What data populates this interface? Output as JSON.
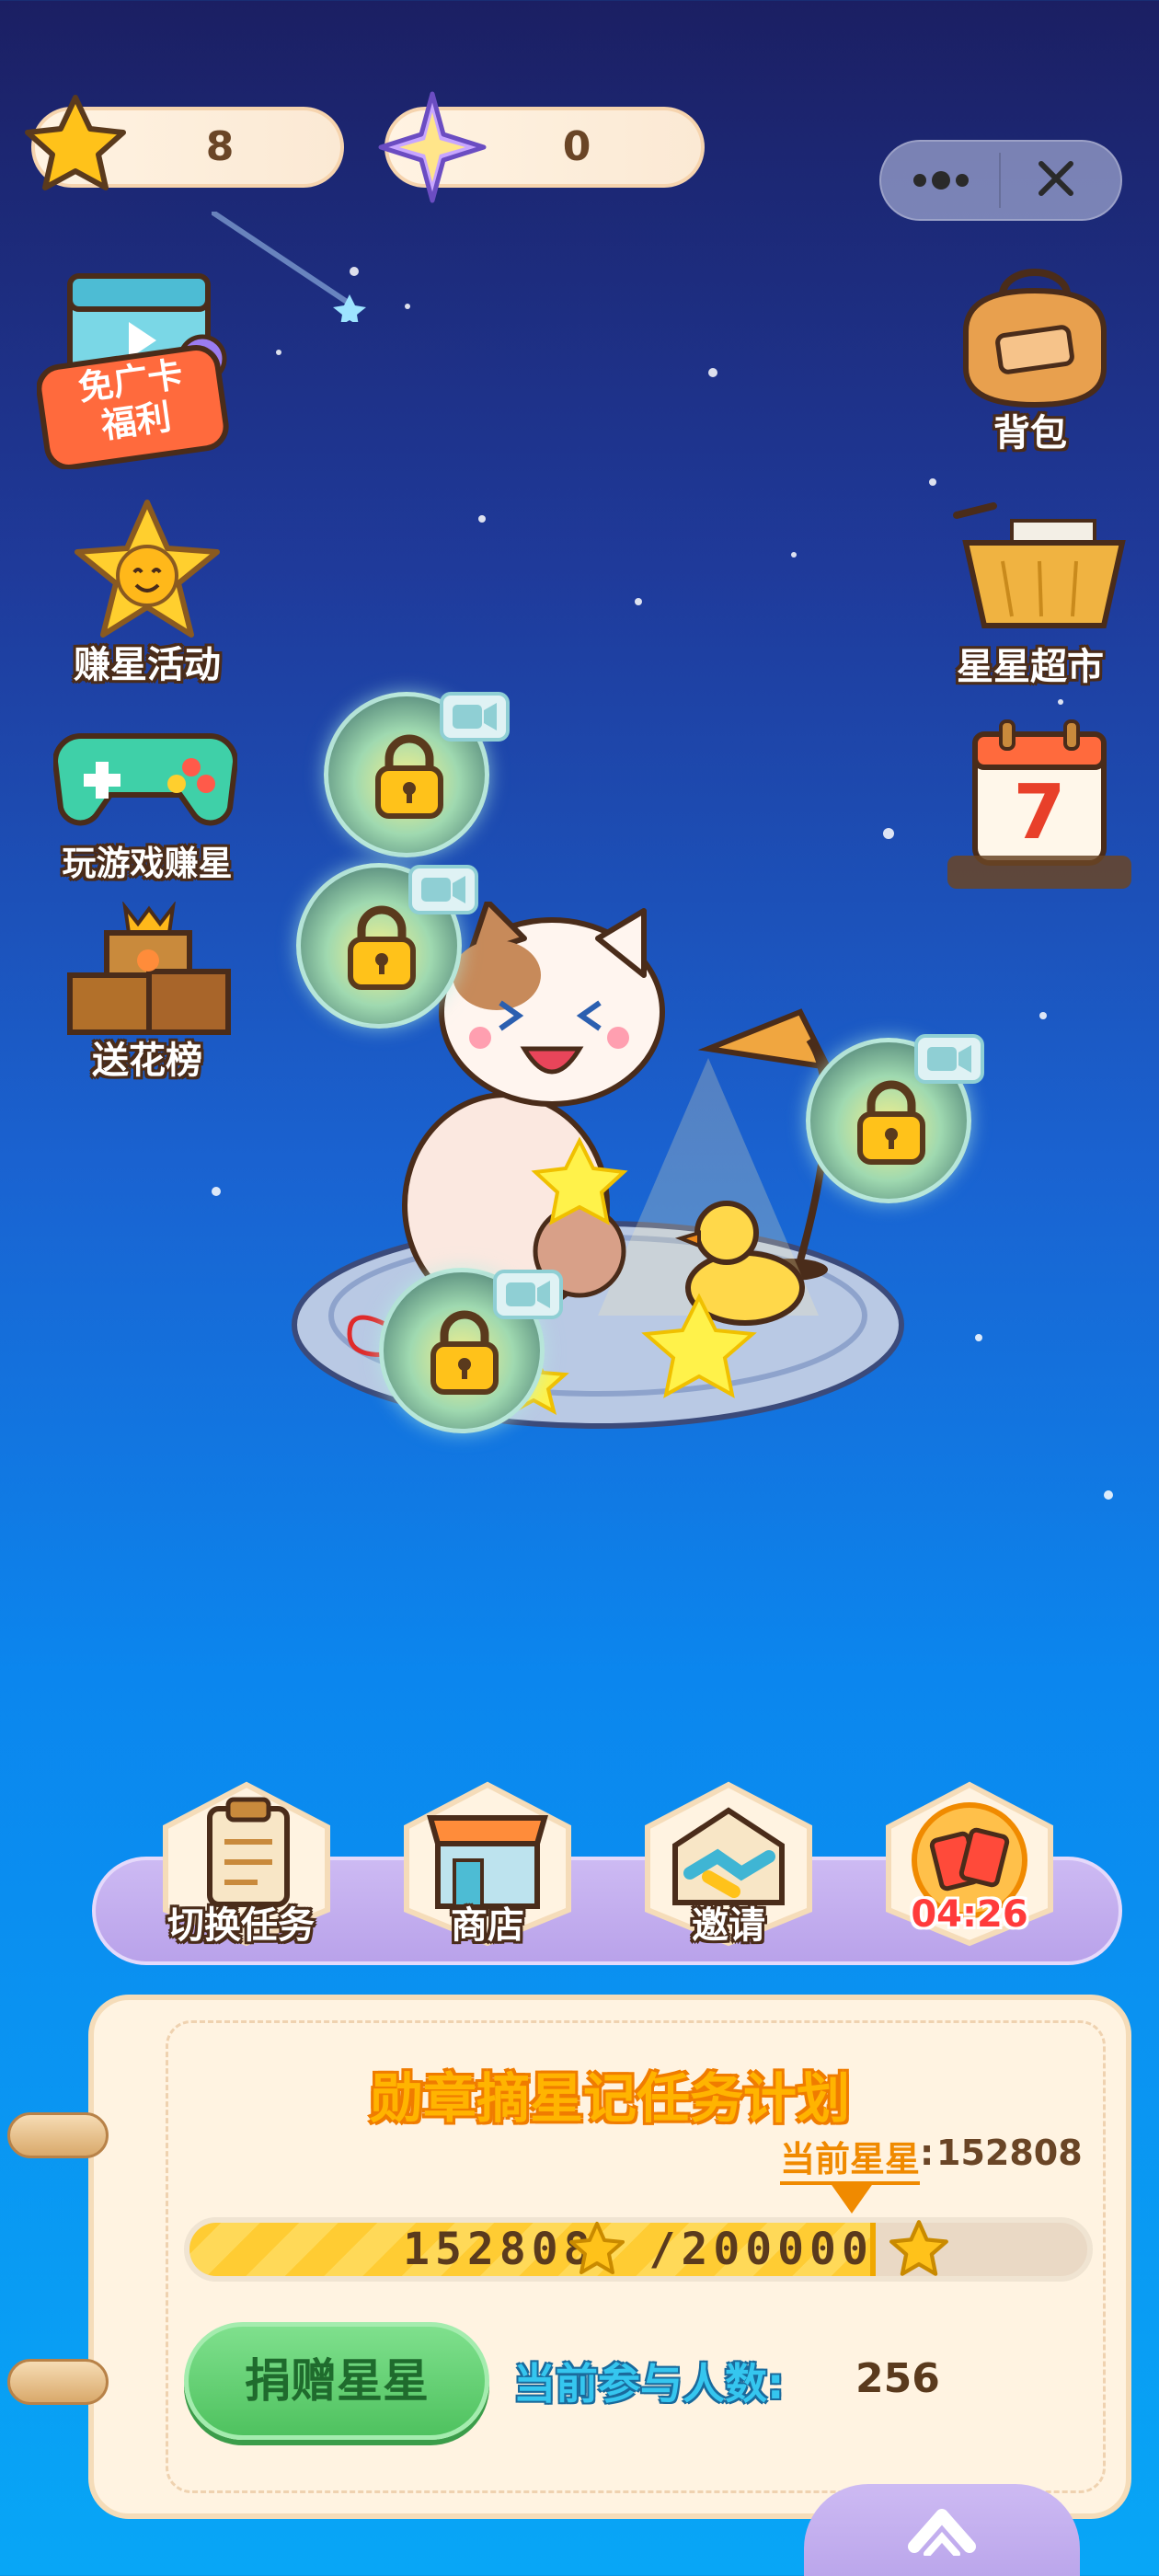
{
  "currency": {
    "stars": "8",
    "crystals": "0"
  },
  "capsule": {
    "more_icon": "more-dots-icon",
    "close_icon": "close-icon"
  },
  "left_menu": [
    {
      "label_line1": "免广卡",
      "label_line2": "福利",
      "icon": "ad-free-card-icon"
    },
    {
      "label": "赚星活动",
      "icon": "smiling-star-icon"
    },
    {
      "label": "玩游戏赚星",
      "icon": "gamepad-icon"
    },
    {
      "label": "送花榜",
      "icon": "flower-box-icon"
    }
  ],
  "right_menu": [
    {
      "label": "背包",
      "icon": "backpack-icon"
    },
    {
      "label": "星星超市",
      "icon": "shopping-cart-icon"
    },
    {
      "label": "",
      "icon": "calendar-7-icon",
      "calendar_number": "7"
    }
  ],
  "toolbar": {
    "items": [
      {
        "label": "切换任务",
        "icon": "task-clipboard-icon"
      },
      {
        "label": "商店",
        "icon": "shop-icon"
      },
      {
        "label": "邀请",
        "icon": "handshake-icon"
      },
      {
        "label": "04:26",
        "icon": "red-envelope-icon"
      }
    ]
  },
  "task_panel": {
    "title": "勋章摘星记任务计划",
    "current_stars_label": "当前星星",
    "current_stars_value": "152808",
    "progress_current": "152808",
    "progress_target": "200000",
    "progress_fraction": 0.764,
    "donate_label": "捐赠星星",
    "participants_label": "当前参与人数:",
    "participants_value": "256"
  },
  "colors": {
    "accent_orange": "#f08a00",
    "progress_yellow": "#ffcc33",
    "donate_green": "#4fc25f",
    "sky_top": "#1b1f63",
    "sky_bottom": "#08a6f6"
  }
}
